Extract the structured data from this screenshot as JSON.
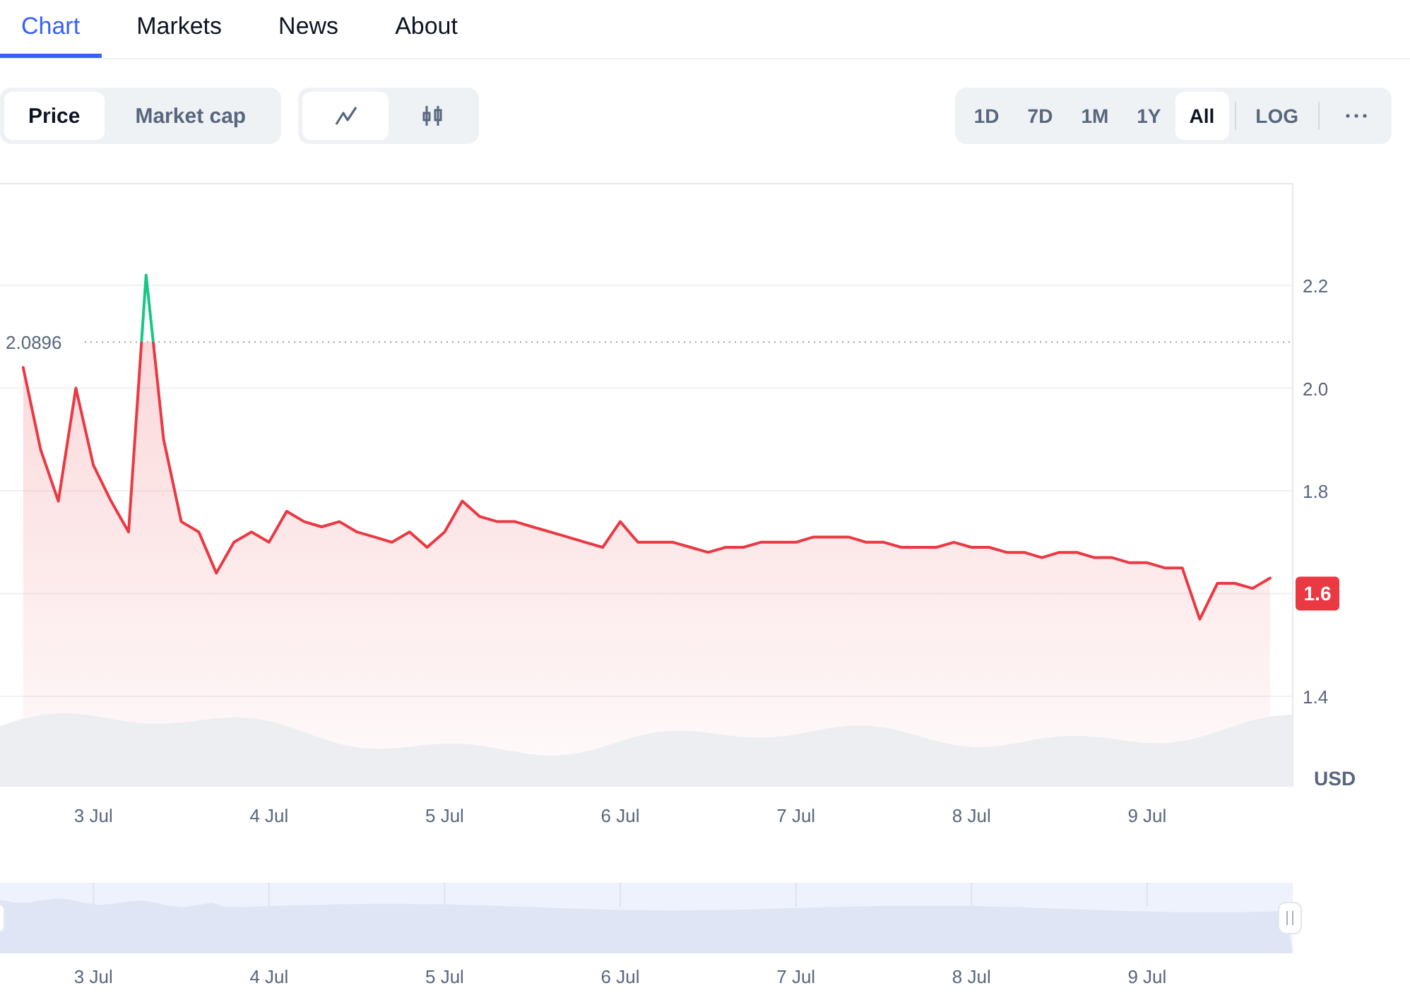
{
  "tabs": [
    {
      "label": "Chart",
      "selected": true
    },
    {
      "label": "Markets",
      "selected": false
    },
    {
      "label": "News",
      "selected": false
    },
    {
      "label": "About",
      "selected": false
    }
  ],
  "metric_toggle": [
    {
      "label": "Price",
      "selected": true
    },
    {
      "label": "Market cap",
      "selected": false
    }
  ],
  "chart_type_toggle": [
    {
      "kind": "line",
      "selected": true
    },
    {
      "kind": "candlestick",
      "selected": false
    }
  ],
  "ranges": [
    {
      "label": "1D",
      "selected": false
    },
    {
      "label": "7D",
      "selected": false
    },
    {
      "label": "1M",
      "selected": false
    },
    {
      "label": "1Y",
      "selected": false
    },
    {
      "label": "All",
      "selected": true
    }
  ],
  "scale_button": {
    "label": "LOG",
    "selected": false
  },
  "chart": {
    "chart_data": {
      "type": "area",
      "ylabel": "USD",
      "grid": true,
      "ylim": [
        1.224,
        2.398
      ],
      "categories": [
        null,
        null,
        null,
        null,
        "3 Jul",
        null,
        null,
        null,
        null,
        null,
        null,
        null,
        null,
        null,
        "4 Jul",
        null,
        null,
        null,
        null,
        null,
        null,
        null,
        null,
        null,
        "5 Jul",
        null,
        null,
        null,
        null,
        null,
        null,
        null,
        null,
        null,
        "6 Jul",
        null,
        null,
        null,
        null,
        null,
        null,
        null,
        null,
        null,
        "7 Jul",
        null,
        null,
        null,
        null,
        null,
        null,
        null,
        null,
        null,
        "8 Jul",
        null,
        null,
        null,
        null,
        null,
        null,
        null,
        null,
        null,
        "9 Jul",
        null,
        null,
        null,
        null,
        null,
        null,
        null
      ],
      "series": [
        {
          "color": "#ea3943",
          "values": [
            2.04,
            1.88,
            1.78,
            2.0,
            1.85,
            1.78,
            1.72,
            2.22,
            1.9,
            1.74,
            1.72,
            1.64,
            1.7,
            1.72,
            1.7,
            1.76,
            1.74,
            1.73,
            1.74,
            1.72,
            1.71,
            1.7,
            1.72,
            1.69,
            1.72,
            1.78,
            1.75,
            1.74,
            1.74,
            1.73,
            1.72,
            1.71,
            1.7,
            1.69,
            1.74,
            1.7,
            1.7,
            1.7,
            1.69,
            1.68,
            1.69,
            1.69,
            1.7,
            1.7,
            1.7,
            1.71,
            1.71,
            1.71,
            1.7,
            1.7,
            1.69,
            1.69,
            1.69,
            1.7,
            1.69,
            1.69,
            1.68,
            1.68,
            1.67,
            1.68,
            1.68,
            1.67,
            1.67,
            1.66,
            1.66,
            1.65,
            1.65,
            1.55,
            1.62,
            1.62,
            1.61,
            1.63
          ]
        }
      ],
      "yticks": [
        1.4,
        1.8,
        {
          "value": 2.0,
          "label": "2.0"
        },
        2.2
      ],
      "ref_lines": [
        {
          "axis": "y",
          "value": 2.0896,
          "label": "2.0896",
          "color": "#9aa2b0"
        },
        {
          "axis": "y",
          "value": 1.6,
          "label": "1.6"
        }
      ]
    }
  },
  "navigator": {
    "labels": [
      "3 Jul",
      "4 Jul",
      "5 Jul",
      "6 Jul",
      "7 Jul",
      "8 Jul",
      "9 Jul"
    ]
  }
}
